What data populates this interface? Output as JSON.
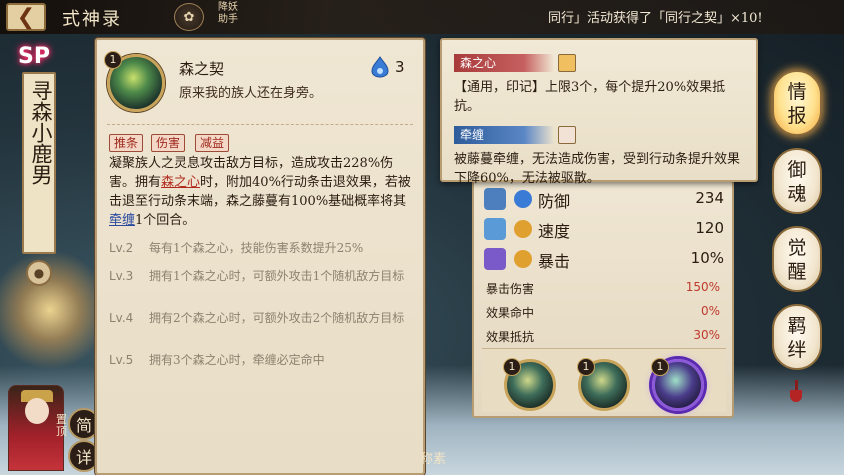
{
  "header": {
    "back_icon": "back-arrow-icon",
    "title": "式神录",
    "helper_label": "降妖助手",
    "notice": "同行」活动获得了「同行之契」×10!"
  },
  "sidebar": {
    "badge": "SP",
    "name": "寻森小鹿男",
    "pin_label": "置顶",
    "simple_label": "简",
    "detail_label": "详"
  },
  "skill": {
    "level": "1",
    "name": "森之契",
    "quote": "原来我的族人还在身旁。",
    "orb_icon": "onmyoji-orb-icon",
    "cost": "3",
    "tags": [
      "推条",
      "伤害",
      "减益"
    ],
    "desc_parts": [
      "凝聚族人之灵息攻击敌方目标，造成攻击228%伤害。拥有",
      "森之心",
      "时，附加40%行动条击退效果，若被击退至行动条末端，森之藤蔓有100%基础概率将其",
      "牵缠",
      "1个回合。"
    ],
    "levels": [
      {
        "lv": "Lv.2",
        "text": "每有1个森之心，技能伤害系数提升25%"
      },
      {
        "lv": "Lv.3",
        "text": "拥有1个森之心时，可额外攻击1个随机敌方目标"
      },
      {
        "lv": "Lv.4",
        "text": "拥有2个森之心时，可额外攻击2个随机敌方目标"
      },
      {
        "lv": "Lv.5",
        "text": "拥有3个森之心时，牵缠必定命中"
      }
    ]
  },
  "tooltip": [
    {
      "head": "森之心",
      "icon": "flame-buff-icon",
      "text": "【通用，印记】上限3个，每个提升20%效果抵抗。"
    },
    {
      "head": "牵缠",
      "icon": "bind-debuff-icon",
      "text": "被藤蔓牵缠，无法造成伤害，受到行动条提升效果下降60%，无法被驱散。"
    }
  ],
  "stats": {
    "rows": [
      {
        "name": "防御",
        "value": "234"
      },
      {
        "name": "速度",
        "value": "120"
      },
      {
        "name": "暴击",
        "value": "10%"
      }
    ],
    "subs": [
      {
        "name": "暴击伤害",
        "value": "150%"
      },
      {
        "name": "效果命中",
        "value": "0%"
      },
      {
        "name": "效果抵抗",
        "value": "30%"
      }
    ],
    "slots": [
      "1",
      "1",
      "1"
    ]
  },
  "nav": [
    {
      "label": "情报",
      "chars": [
        "情",
        "报"
      ]
    },
    {
      "label": "御魂",
      "chars": [
        "御",
        "魂"
      ]
    },
    {
      "label": "觉醒",
      "chars": [
        "觉",
        "醒"
      ]
    },
    {
      "label": "羁绊",
      "chars": [
        "羁",
        "绊"
      ]
    }
  ],
  "bottom_text": "称素"
}
